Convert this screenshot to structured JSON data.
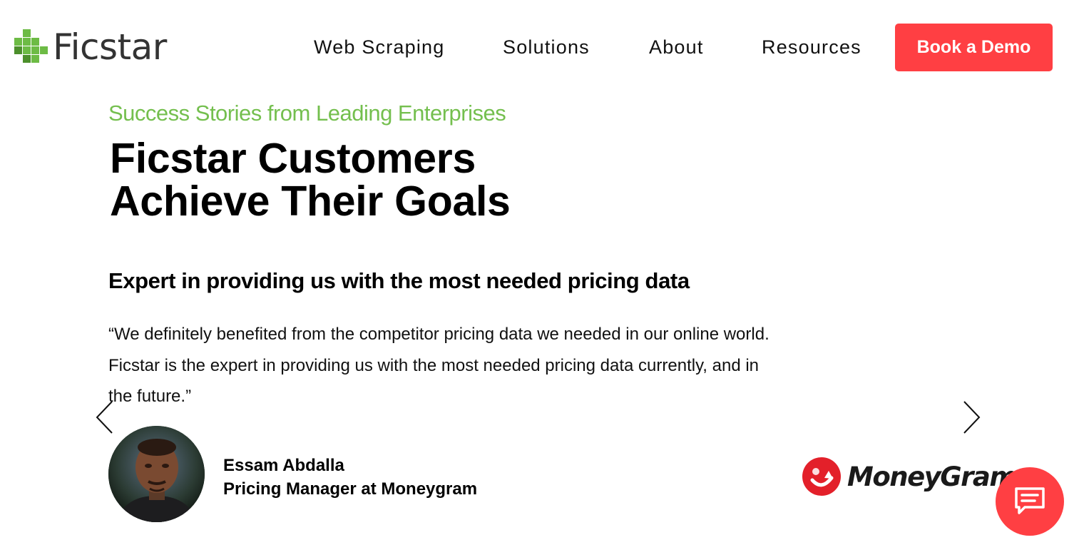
{
  "header": {
    "logo_text": "Ficstar",
    "nav": [
      {
        "label": "Web Scraping"
      },
      {
        "label": "Solutions"
      },
      {
        "label": "About"
      },
      {
        "label": "Resources"
      }
    ],
    "cta_label": "Book a Demo"
  },
  "hero": {
    "eyebrow": "Success Stories from Leading Enterprises",
    "headline_line1": "Ficstar Customers",
    "headline_line2": "Achieve Their Goals"
  },
  "testimonial": {
    "title": "Expert in providing us with the most needed pricing data",
    "quote": "“We definitely benefited from the competitor pricing data we needed in our online world. Ficstar is the expert in providing us with the most needed pricing data currently, and in the future.”",
    "person_name": "Essam Abdalla",
    "person_role": "Pricing Manager at Moneygram",
    "company_logo_text": "MoneyGram."
  },
  "icons": {
    "prev": "chevron-left-icon",
    "next": "chevron-right-icon",
    "chat": "chat-icon"
  },
  "colors": {
    "accent_red": "#ff3f43",
    "accent_green": "#74bf4e",
    "logo_green": "#6dbb45"
  }
}
